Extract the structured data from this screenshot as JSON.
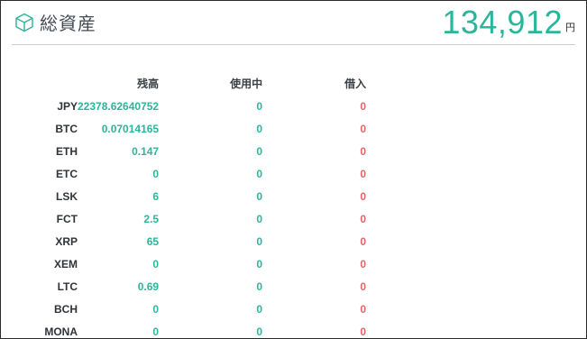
{
  "header": {
    "title": "総資産",
    "total_value": "134,912",
    "total_unit": "円",
    "icon": "cube-icon"
  },
  "table": {
    "headers": {
      "balance": "残高",
      "in_use": "使用中",
      "borrowed": "借入"
    },
    "rows": [
      {
        "symbol": "JPY",
        "balance": "22378.62640752",
        "in_use": "0",
        "borrowed": "0"
      },
      {
        "symbol": "BTC",
        "balance": "0.07014165",
        "in_use": "0",
        "borrowed": "0"
      },
      {
        "symbol": "ETH",
        "balance": "0.147",
        "in_use": "0",
        "borrowed": "0"
      },
      {
        "symbol": "ETC",
        "balance": "0",
        "in_use": "0",
        "borrowed": "0"
      },
      {
        "symbol": "LSK",
        "balance": "6",
        "in_use": "0",
        "borrowed": "0"
      },
      {
        "symbol": "FCT",
        "balance": "2.5",
        "in_use": "0",
        "borrowed": "0"
      },
      {
        "symbol": "XRP",
        "balance": "65",
        "in_use": "0",
        "borrowed": "0"
      },
      {
        "symbol": "XEM",
        "balance": "0",
        "in_use": "0",
        "borrowed": "0"
      },
      {
        "symbol": "LTC",
        "balance": "0.69",
        "in_use": "0",
        "borrowed": "0"
      },
      {
        "symbol": "BCH",
        "balance": "0",
        "in_use": "0",
        "borrowed": "0"
      },
      {
        "symbol": "MONA",
        "balance": "0",
        "in_use": "0",
        "borrowed": "0"
      }
    ]
  },
  "colors": {
    "accent_green": "#2bb59a",
    "borrow_red": "#e0636a",
    "text_dark": "#2f3338",
    "divider": "#c9cdd1"
  }
}
